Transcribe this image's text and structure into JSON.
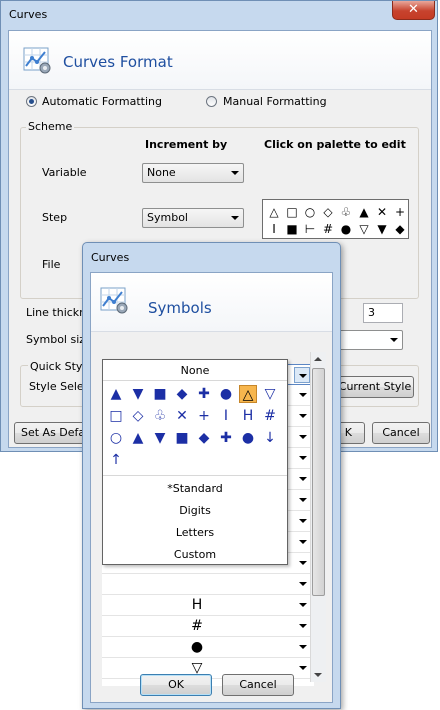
{
  "curves_window": {
    "title": "Curves",
    "close_label": "✕",
    "header_title": "Curves Format",
    "auto_formatting_label": "Automatic Formatting",
    "manual_formatting_label": "Manual Formatting",
    "auto_selected": true,
    "scheme_label": "Scheme",
    "increment_by_header": "Increment by",
    "palette_header": "Click on palette to edit",
    "variable_label": "Variable",
    "variable_value": "None",
    "step_label": "Step",
    "step_value": "Symbol",
    "file_label": "File",
    "palette_row1": [
      "△",
      "□",
      "○",
      "◇",
      "♧",
      "▲",
      "✕",
      "+"
    ],
    "palette_row2": [
      "I",
      "■",
      "⊢",
      "#",
      "●",
      "▽",
      "▼",
      "◆"
    ],
    "line_thickness_label": "Line thickne",
    "line_thickness_value": "3",
    "symbol_size_label": "Symbol size",
    "quick_styles_label": "Quick Styles",
    "style_select_label": "Style Selec",
    "current_style_button": "Current Style",
    "set_as_default_button": "Set As Defau",
    "ok_button": "K",
    "cancel_button": "Cancel"
  },
  "symbols_window": {
    "title": "Curves",
    "header_title": "Symbols",
    "rows": [
      "△",
      "",
      "",
      "",
      "",
      "",
      "",
      "",
      "",
      "",
      "",
      "H",
      "#",
      "●",
      "▽",
      "▬"
    ],
    "ok_button": "OK",
    "cancel_button": "Cancel"
  },
  "symbol_dropdown": {
    "none_label": "None",
    "row1": [
      "▲",
      "▼",
      "■",
      "◆",
      "✚",
      "●",
      "△",
      "▽"
    ],
    "row2": [
      "□",
      "◇",
      "♧",
      "✕",
      "+",
      "I",
      "H",
      "#"
    ],
    "row3": [
      "○",
      "▲",
      "▼",
      "■",
      "◆",
      "✚",
      "●",
      "↓"
    ],
    "row4": [
      "↑"
    ],
    "selected_symbol": "△",
    "items": [
      "*Standard",
      "Digits",
      "Letters",
      "Custom"
    ]
  },
  "colors": {
    "title_blue": "#1f4fa0",
    "symbol_blue": "#1c2fa5",
    "selection_orange": "#f7b64d",
    "window_frame": "#c6d9ee"
  }
}
